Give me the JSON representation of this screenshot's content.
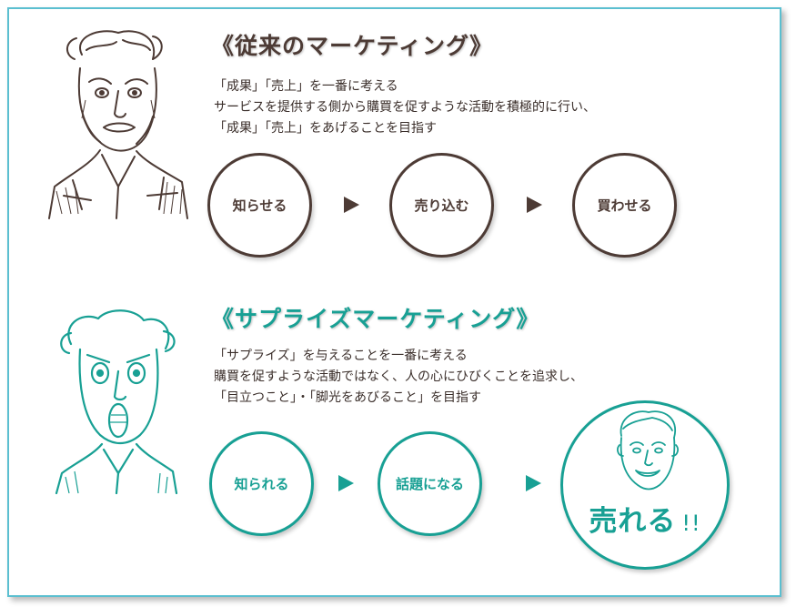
{
  "traditional": {
    "title": "《従来のマーケティング》",
    "lines": [
      "「成果」「売上」を一番に考える",
      "サービスを提供する側から購買を促すような活動を積極的に行い、",
      "「成果」「売上」をあげることを目指す"
    ],
    "steps": [
      "知らせる",
      "売り込む",
      "買わせる"
    ]
  },
  "surprise": {
    "title": "《サプライズマーケティング》",
    "lines": [
      "「サプライズ」を与えることを一番に考える",
      "購買を促すような活動ではなく、人の心にひびくことを追求し、",
      "「目立つこと」・「脚光をあびること」を目指す"
    ],
    "steps": [
      "知られる",
      "話題になる"
    ],
    "result": "売れる",
    "result_mark": "!!"
  },
  "colors": {
    "brown": "#4d3b35",
    "teal": "#18a094",
    "frame": "#5bbfd0"
  },
  "icons": [
    "old-man-sketch-illustration",
    "surprised-man-sketch-illustration",
    "smiling-man-sketch-illustration",
    "arrow-right-icon"
  ]
}
